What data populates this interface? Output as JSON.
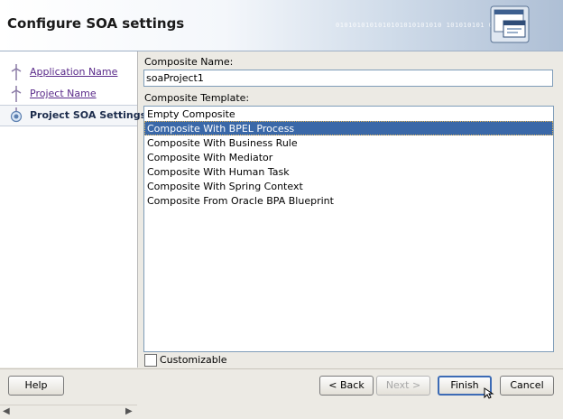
{
  "dialog": {
    "title": "Configure SOA settings",
    "header_binary": "0101010101010101010101010 101010101 0"
  },
  "steps": [
    {
      "label": "Application Name",
      "state": "visited"
    },
    {
      "label": "Project Name",
      "state": "visited"
    },
    {
      "label": "Project SOA Settings",
      "state": "current"
    }
  ],
  "composite_name": {
    "label": "Composite Name:",
    "value": "soaProject1"
  },
  "composite_template": {
    "label": "Composite Template:",
    "items": [
      "Empty Composite",
      "Composite With BPEL Process",
      "Composite With Business Rule",
      "Composite With Mediator",
      "Composite With Human Task",
      "Composite With Spring Context",
      "Composite From Oracle BPA Blueprint"
    ],
    "selected_index": 1
  },
  "customizable": {
    "label": "Customizable",
    "checked": false
  },
  "buttons": {
    "help": "Help",
    "back": "< Back",
    "next": "Next >",
    "finish": "Finish",
    "cancel": "Cancel"
  },
  "colors": {
    "selection": "#3a68a8",
    "step_link": "#5a2a8a",
    "default_button_border": "#3c6bb5"
  }
}
